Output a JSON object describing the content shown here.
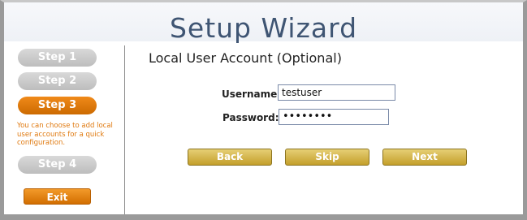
{
  "header": {
    "title": "Setup Wizard"
  },
  "sidebar": {
    "steps": [
      {
        "label": "Step 1",
        "state": "inactive"
      },
      {
        "label": "Step 2",
        "state": "inactive"
      },
      {
        "label": "Step 3",
        "state": "active"
      },
      {
        "label": "Step 4",
        "state": "inactive"
      }
    ],
    "hint": "You can choose to add local user accounts for a quick configuration.",
    "exit_label": "Exit"
  },
  "main": {
    "section_title": "Local User Account (Optional)",
    "username": {
      "label": "Username:",
      "value": "testuser"
    },
    "password": {
      "label": "Password:",
      "value": "••••••••"
    },
    "buttons": {
      "back": "Back",
      "skip": "Skip",
      "next": "Next"
    }
  },
  "colors": {
    "title": "#3f5573",
    "active_step": "#e07a10",
    "inactive_step": "#c8c8c8",
    "gold_button": "#d4b448"
  }
}
